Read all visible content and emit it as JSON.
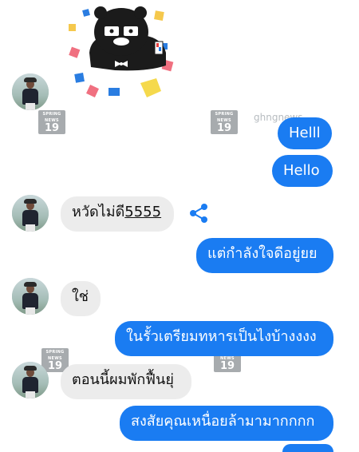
{
  "watermark": {
    "brand_top": "SPRING",
    "brand_mid": "NEWS",
    "channel": "19",
    "url_text": "ghngnews"
  },
  "messages": [
    {
      "side": "in",
      "text": "หวัดไม่ดี",
      "underlined_suffix": "5555"
    },
    {
      "side": "out",
      "text": "Helll"
    },
    {
      "side": "out",
      "text": "Hello"
    },
    {
      "side": "out",
      "text": "แต่กำลังใจดีอยู่ยย"
    },
    {
      "side": "in",
      "text": "ใช่"
    },
    {
      "side": "out",
      "text": "ในรั้วเตรียมทหารเป็นไงบ้างงงง"
    },
    {
      "side": "in",
      "text": "ตอนนี้ผมพักฟื้นยุ่"
    },
    {
      "side": "out",
      "text": "สงสัยคุณเหนื่อยล้ามามากกกก"
    }
  ],
  "icons": {
    "share": "share-icon",
    "sticker": "sticker-bear-car"
  },
  "colors": {
    "outgoing_bubble": "#1a7cf2",
    "incoming_bubble": "#ececec",
    "share_icon": "#1a7cf2"
  }
}
